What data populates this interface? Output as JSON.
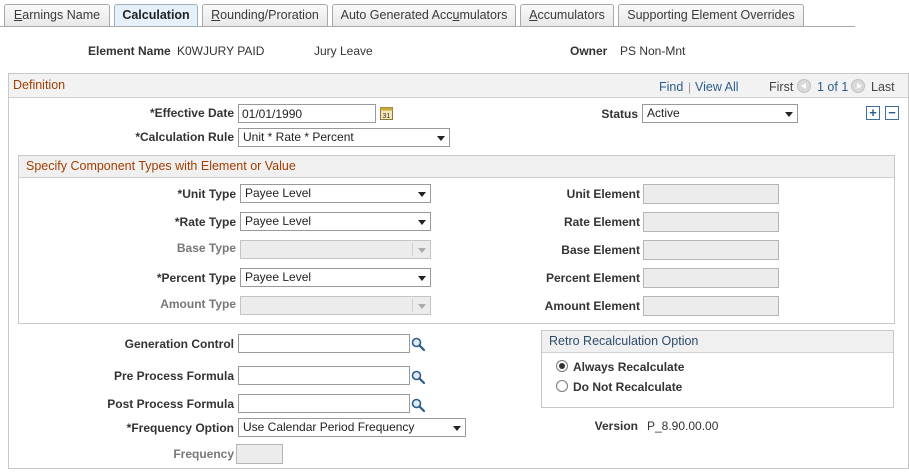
{
  "tabs": [
    {
      "label": "Earnings Name",
      "underline_char": "E",
      "rest": "arnings Name",
      "active": false
    },
    {
      "label": "Calculation",
      "underline_char": "",
      "rest": "Calculation",
      "active": true
    },
    {
      "label": "Rounding/Proration",
      "underline_char": "R",
      "rest": "ounding/Proration",
      "active": false
    },
    {
      "label": "Auto Generated Accumulators",
      "underline_char": "",
      "rest": "Auto Generated Acc",
      "rest_u": "u",
      "rest2": "mulators",
      "active": false
    },
    {
      "label": "Accumulators",
      "underline_char": "A",
      "rest": "ccumulators",
      "active": false
    },
    {
      "label": "Supporting Element Overrides",
      "underline_char": "",
      "rest": "Supporting Element Overrides",
      "active": false
    }
  ],
  "header": {
    "element_name_label": "Element Name",
    "element_name_value": "K0WJURY PAID",
    "element_desc": "Jury Leave",
    "owner_label": "Owner",
    "owner_value": "PS Non-Mnt"
  },
  "definition": {
    "title": "Definition",
    "find": "Find",
    "view_all": "View All",
    "sep": "|",
    "first": "First",
    "paging": "1 of 1",
    "last": "Last",
    "effective_date_label": "*Effective Date",
    "effective_date_value": "01/01/1990",
    "status_label": "Status",
    "status_value": "Active",
    "calc_rule_label": "*Calculation Rule",
    "calc_rule_value": "Unit * Rate * Percent"
  },
  "components": {
    "title": "Specify Component Types with Element or Value",
    "unit_type_label": "*Unit Type",
    "unit_type_value": "Payee Level",
    "rate_type_label": "*Rate Type",
    "rate_type_value": "Payee Level",
    "base_type_label": "Base Type",
    "base_type_value": "",
    "percent_type_label": "*Percent Type",
    "percent_type_value": "Payee Level",
    "amount_type_label": "Amount Type",
    "amount_type_value": "",
    "unit_element_label": "Unit Element",
    "rate_element_label": "Rate Element",
    "base_element_label": "Base Element",
    "percent_element_label": "Percent Element",
    "amount_element_label": "Amount Element"
  },
  "lower": {
    "generation_control_label": "Generation Control",
    "generation_control_value": "",
    "pre_process_label": "Pre Process Formula",
    "pre_process_value": "",
    "post_process_label": "Post Process Formula",
    "post_process_value": "",
    "frequency_option_label": "*Frequency Option",
    "frequency_option_value": "Use Calendar Period Frequency",
    "frequency_label": "Frequency",
    "frequency_value": "",
    "version_label": "Version",
    "version_value": "P_8.90.00.00"
  },
  "retro": {
    "title": "Retro Recalculation Option",
    "always_label": "Always Recalculate",
    "always_selected": true,
    "dont_label": "Do Not Recalculate",
    "dont_selected": false
  },
  "colors": {
    "definition_title": "#a33e00",
    "section_title": "#a33e00",
    "retro_title": "#2d4c6e",
    "link": "#2b5d8c"
  },
  "icons": {
    "calendar": "calendar-icon",
    "lookup": "lookup-icon",
    "add": "add-row-icon",
    "delete": "delete-row-icon",
    "prev": "previous-icon",
    "next": "next-icon"
  }
}
